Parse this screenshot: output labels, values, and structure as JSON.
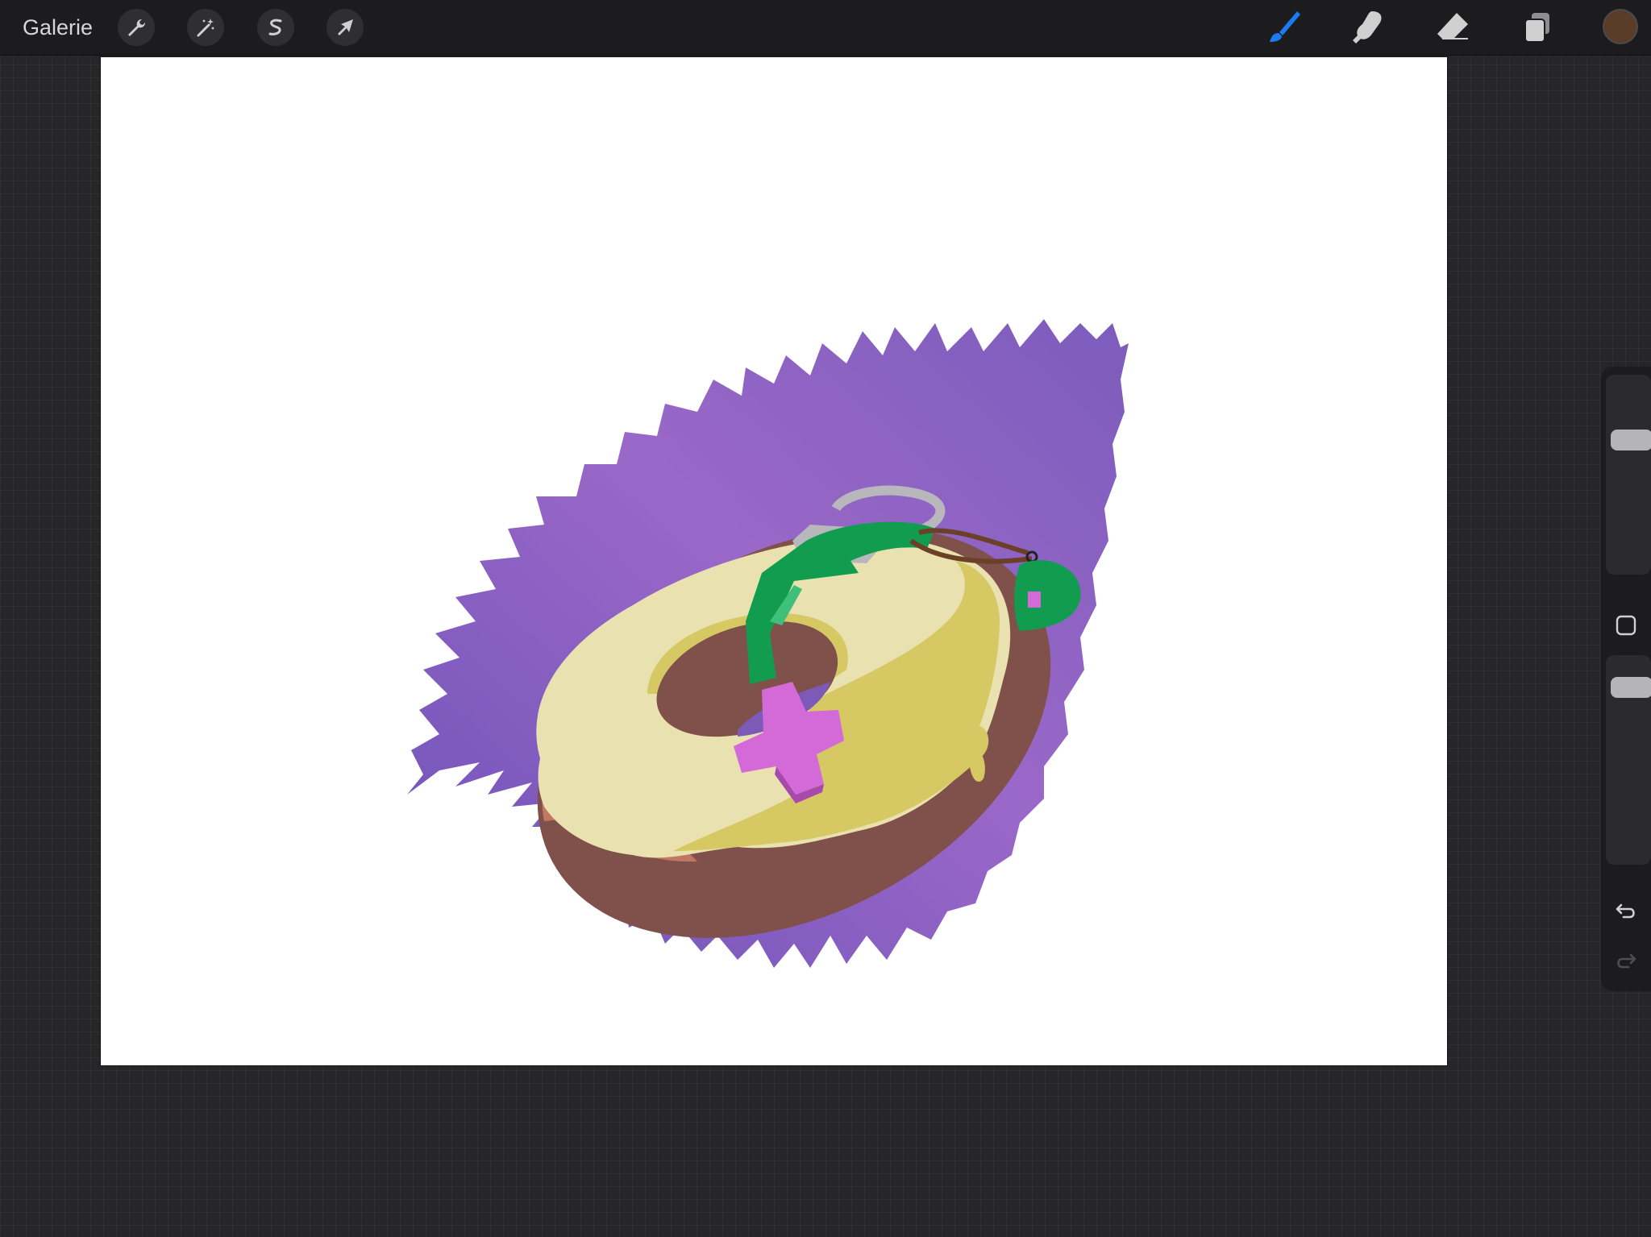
{
  "app": {
    "gallery_label": "Galerie"
  },
  "toolbar_left": [
    {
      "name": "actions",
      "icon": "wrench-icon"
    },
    {
      "name": "adjustments",
      "icon": "magic-wand-icon"
    },
    {
      "name": "selection",
      "icon": "selection-s-icon"
    },
    {
      "name": "transform",
      "icon": "arrow-cursor-icon"
    }
  ],
  "toolbar_right": [
    {
      "name": "brush",
      "icon": "brush-icon",
      "active": true
    },
    {
      "name": "smudge",
      "icon": "smudge-finger-icon",
      "active": false
    },
    {
      "name": "eraser",
      "icon": "eraser-icon",
      "active": false
    },
    {
      "name": "layers",
      "icon": "layers-icon",
      "active": false
    }
  ],
  "current_color": "#5a3c28",
  "colors": {
    "topbar": "#1c1c1e",
    "accent_active": "#1a7cf0",
    "icon": "#d0d0d0",
    "canvas": "#ffffff",
    "purple": "#7e5ab8",
    "glaze": "#e9e2b0",
    "glaze_shadow": "#d6c963",
    "dough": "#80504a",
    "dough_light": "#c27860",
    "strap": "#129c50",
    "buckle": "#b8b8bc",
    "plus": "#d46ad8"
  },
  "sidebar": {
    "brush_size_level": 0.7,
    "opacity_level": 0.9,
    "modify_button_icon": "square-icon",
    "undo_icon": "undo-icon",
    "redo_icon": "redo-icon",
    "redo_enabled": false
  },
  "artwork": {
    "subject": "glazed-donut-with-strap",
    "elements": [
      "purple-paint-splash",
      "donut-body",
      "glaze",
      "green-strap",
      "metal-buckle",
      "pink-plus-sprinkle",
      "green-keychain"
    ]
  }
}
